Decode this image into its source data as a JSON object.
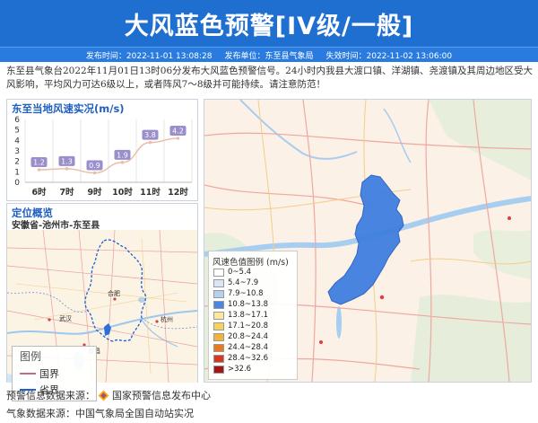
{
  "header": {
    "title": "大风蓝色预警[IV级/一般]",
    "publish_time": "发布时间：2022-11-01 13:08:28",
    "publisher": "发布单位：东至县气象局",
    "expire_time": "失效时间：2022-11-02 13:06:00"
  },
  "description": "东至县气象台2022年11月01日13时06分发布大风蓝色预警信号。24小时内我县大渡口镇、洋湖镇、尧渡镇及其周边地区受大风影响，平均风力可达6级以上，或者阵风7～8级并可能持续。请注意防范！",
  "wind_panel": {
    "title": "东至当地风速实况(m/s)"
  },
  "chart_data": {
    "type": "line",
    "title": "东至当地风速实况(m/s)",
    "categories": [
      "6时",
      "7时",
      "9时",
      "10时",
      "11时",
      "12时"
    ],
    "values": [
      1.2,
      1.3,
      0.9,
      1.9,
      3.8,
      4.2
    ],
    "value_labels": [
      "1.2",
      "1.3",
      "0.9",
      "1.9",
      "3.8",
      "4.2"
    ],
    "yticks": [
      "0",
      "1",
      "2",
      "3",
      "4",
      "5",
      "6"
    ],
    "ylim": [
      0,
      6
    ],
    "grid": "vertical",
    "line_color": "#e9bfa8",
    "label_color": "#9a8ecb"
  },
  "location_panel": {
    "title": "定位概览",
    "place": "安徽省-池州市-东至县",
    "city_labels": [
      "合肥",
      "武汉",
      "杭州",
      "南昌"
    ],
    "legend_title": "图例",
    "legend_items": [
      {
        "label": "国界",
        "color": "#c46a8a"
      },
      {
        "label": "省界",
        "color": "#1f5fd1"
      }
    ]
  },
  "speed_legend": {
    "title": "风速色值图例 (m/s)",
    "items": [
      {
        "label": "0~5.4",
        "color": "#ffffff"
      },
      {
        "label": "5.4~7.9",
        "color": "#d8e6f5"
      },
      {
        "label": "7.9~10.8",
        "color": "#b6d1ef"
      },
      {
        "label": "10.8~13.8",
        "color": "#4a86e6"
      },
      {
        "label": "13.8~17.1",
        "color": "#fbe89b"
      },
      {
        "label": "17.1~20.8",
        "color": "#f6d35a"
      },
      {
        "label": "20.8~24.4",
        "color": "#f2b33a"
      },
      {
        "label": "24.4~28.4",
        "color": "#ea7a1f"
      },
      {
        "label": "28.4~32.6",
        "color": "#d43a1f"
      },
      {
        "label": ">32.6",
        "color": "#a21616"
      }
    ]
  },
  "footer": {
    "warning_source_label": "预警信息数据来源：",
    "warning_source": "国家预警信息发布中心",
    "weather_source": "气象数据来源：中国气象局全国自动站实况"
  }
}
